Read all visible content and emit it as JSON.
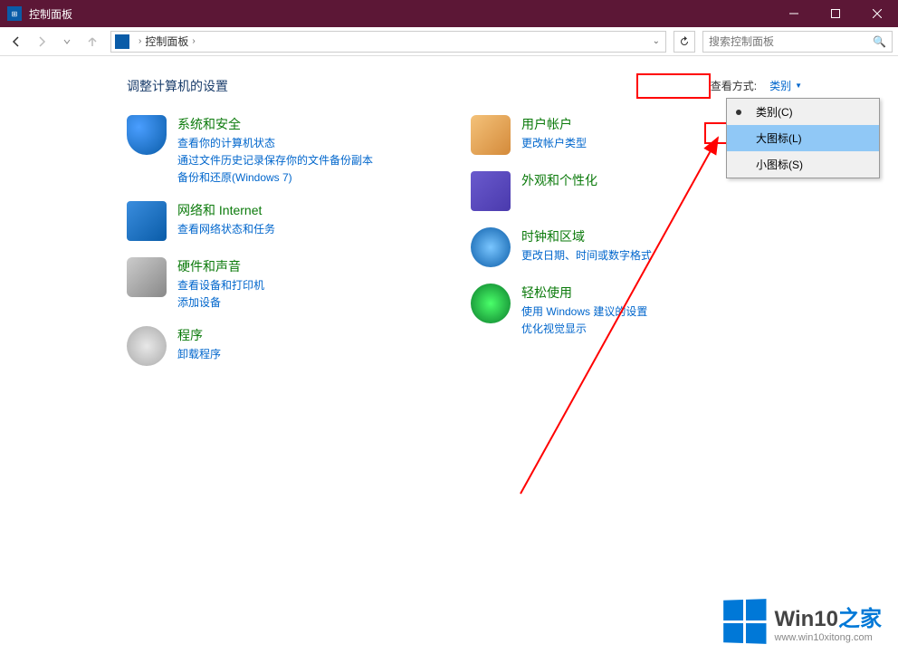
{
  "window": {
    "title": "控制面板"
  },
  "toolbar": {
    "breadcrumb": "控制面板",
    "search_placeholder": "搜索控制面板"
  },
  "page": {
    "title": "调整计算机的设置",
    "view_label": "查看方式:",
    "view_value": "类别"
  },
  "view_menu": {
    "items": [
      {
        "label": "类别(C)",
        "checked": true,
        "selected": false
      },
      {
        "label": "大图标(L)",
        "checked": false,
        "selected": true
      },
      {
        "label": "小图标(S)",
        "checked": false,
        "selected": false
      }
    ]
  },
  "categories": {
    "left": [
      {
        "icon": "shield",
        "title": "系统和安全",
        "links": [
          "查看你的计算机状态",
          "通过文件历史记录保存你的文件备份副本",
          "备份和还原(Windows 7)"
        ]
      },
      {
        "icon": "network",
        "title": "网络和 Internet",
        "links": [
          "查看网络状态和任务"
        ]
      },
      {
        "icon": "hardware",
        "title": "硬件和声音",
        "links": [
          "查看设备和打印机",
          "添加设备"
        ]
      },
      {
        "icon": "programs",
        "title": "程序",
        "links": [
          "卸载程序"
        ]
      }
    ],
    "right": [
      {
        "icon": "users",
        "title": "用户帐户",
        "links": [
          "更改帐户类型"
        ]
      },
      {
        "icon": "appearance",
        "title": "外观和个性化",
        "links": []
      },
      {
        "icon": "clock",
        "title": "时钟和区域",
        "links": [
          "更改日期、时间或数字格式"
        ]
      },
      {
        "icon": "ease",
        "title": "轻松使用",
        "links": [
          "使用 Windows 建议的设置",
          "优化视觉显示"
        ]
      }
    ]
  },
  "watermark": {
    "title_main": "Win10",
    "title_accent": "之家",
    "url": "www.win10xitong.com"
  }
}
